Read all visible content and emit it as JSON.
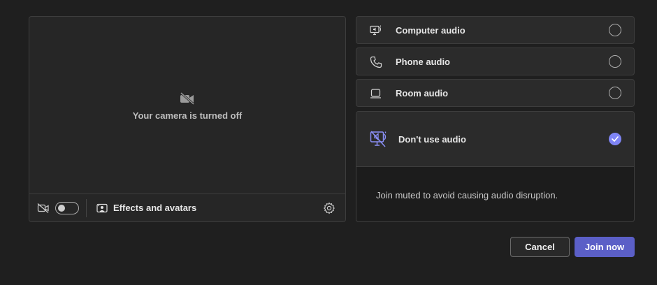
{
  "preview": {
    "camera_off_text": "Your camera is turned off",
    "icons": {
      "camera": "video-off-icon",
      "toolbar_camera": "video-off-icon",
      "effects": "effects-avatar-icon",
      "settings": "gear-icon"
    },
    "camera_toggle_on": false,
    "effects_label": "Effects and avatars"
  },
  "audio": {
    "options": [
      {
        "label": "Computer audio",
        "icon": "computer-speaker-icon",
        "selected": false
      },
      {
        "label": "Phone audio",
        "icon": "phone-icon",
        "selected": false
      },
      {
        "label": "Room audio",
        "icon": "room-display-icon",
        "selected": false
      }
    ],
    "selected_option": {
      "label": "Don't use audio",
      "icon": "speaker-off-icon",
      "selected": true,
      "description": "Join muted to avoid causing audio disruption."
    },
    "accent_color": "#7f85f5"
  },
  "actions": {
    "cancel_label": "Cancel",
    "join_label": "Join now",
    "join_color": "#5b5fc7"
  }
}
